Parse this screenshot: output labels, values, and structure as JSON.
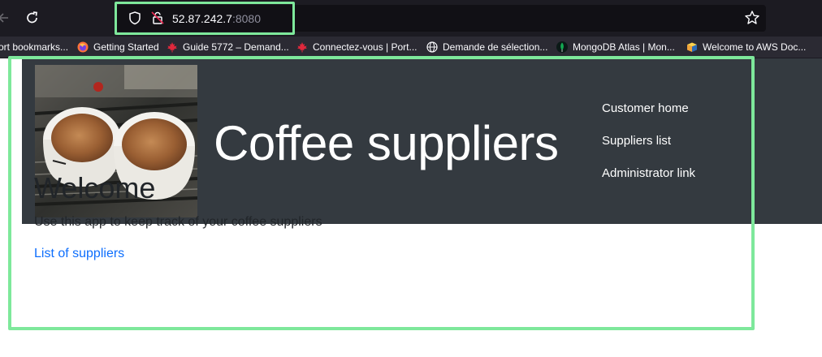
{
  "browser": {
    "url_host": "52.87.242.7",
    "url_port": ":8080",
    "bookmarks": [
      {
        "label": "ort bookmarks...",
        "icon": "folder-icon"
      },
      {
        "label": "Getting Started",
        "icon": "firefox-icon"
      },
      {
        "label": "Guide 5772 – Demand...",
        "icon": "maple-leaf-icon"
      },
      {
        "label": "Connectez-vous | Port...",
        "icon": "maple-leaf-icon"
      },
      {
        "label": "Demande de sélection...",
        "icon": "globe-icon"
      },
      {
        "label": "MongoDB Atlas | Mon...",
        "icon": "mongodb-leaf-icon"
      },
      {
        "label": "Welcome to AWS Doc...",
        "icon": "aws-docs-icon"
      }
    ]
  },
  "header": {
    "title": "Coffee suppliers",
    "nav": [
      {
        "label": "Customer home"
      },
      {
        "label": "Suppliers list"
      },
      {
        "label": "Administrator link"
      }
    ]
  },
  "main": {
    "heading": "Welcome",
    "intro": "Use this app to keep track of your coffee suppliers",
    "link": "List of suppliers"
  },
  "colors": {
    "header_bg": "#343a40",
    "link": "#0d6efd",
    "highlight": "#7ee89b",
    "browser_bg": "#1c1b22"
  }
}
